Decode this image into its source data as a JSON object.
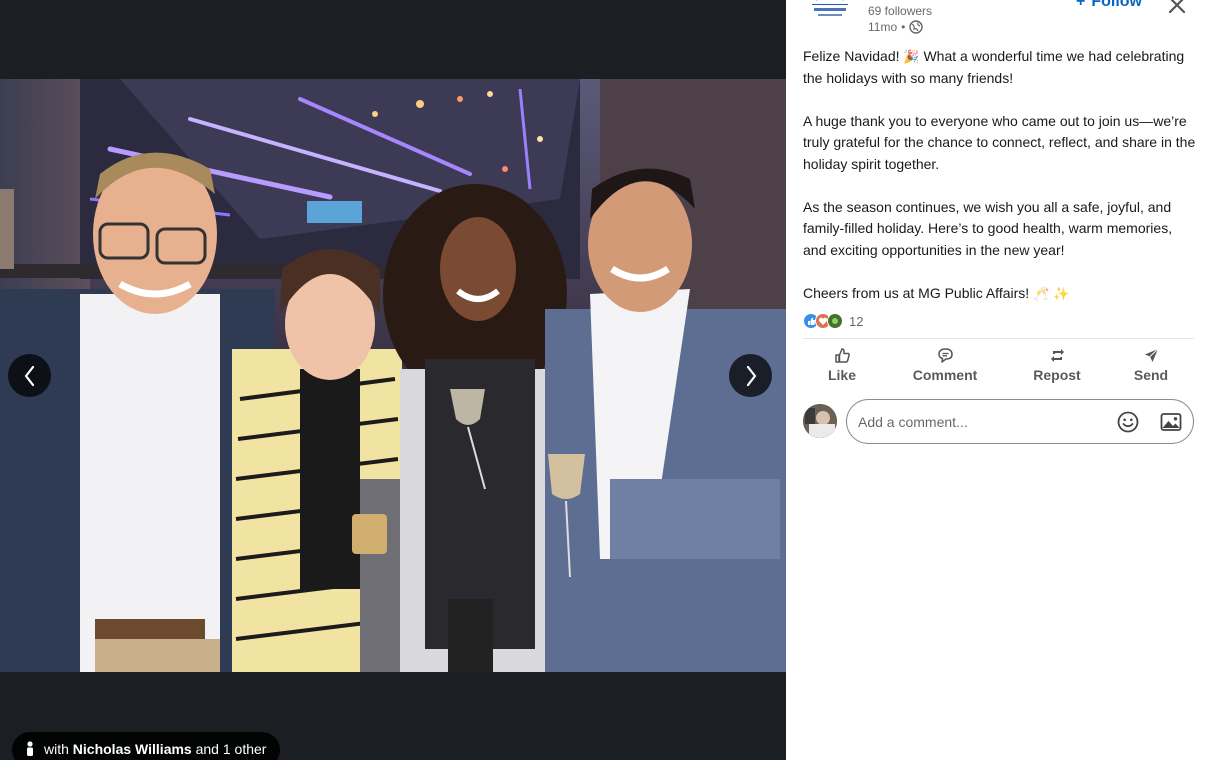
{
  "viewer": {
    "prev_label": "Previous",
    "next_label": "Next",
    "tag": {
      "prefix": "with",
      "name": "Nicholas Williams",
      "suffix": "and 1 other"
    }
  },
  "post": {
    "followers": "69 followers",
    "time": "11mo",
    "separator": "•",
    "follow_plus": "+",
    "follow_label": "Follow",
    "paragraphs": {
      "p1_before": "Felize Navidad!",
      "p1_emoji": "🎉",
      "p1_after": " What a wonderful time we had celebrating the holidays with so many friends!",
      "p2": "A huge thank you to everyone who came out to join us—we’re truly grateful for the chance to connect, reflect, and share in the holiday spirit together.",
      "p3": "As the season continues, we wish you all a safe, joyful, and family-filled holiday. Here’s to good health, warm memories, and exciting opportunities in the new year!",
      "p4_text": "Cheers from us at MG Public Affairs!",
      "p4_emoji_1": "🥂",
      "p4_emoji_2": "✨"
    },
    "reactions_count": "12"
  },
  "actions": {
    "like": "Like",
    "comment": "Comment",
    "repost": "Repost",
    "send": "Send"
  },
  "comment": {
    "placeholder": "Add a comment..."
  },
  "colors": {
    "brand_blue": "#0a66c2",
    "viewer_bg": "#1b1f23",
    "panel_bg": "#ffffff"
  },
  "icons": [
    "chevron-left-icon",
    "chevron-right-icon",
    "person-icon",
    "globe-icon",
    "close-icon",
    "like-icon",
    "comment-icon",
    "repost-icon",
    "send-icon",
    "emoji-icon",
    "image-icon"
  ]
}
